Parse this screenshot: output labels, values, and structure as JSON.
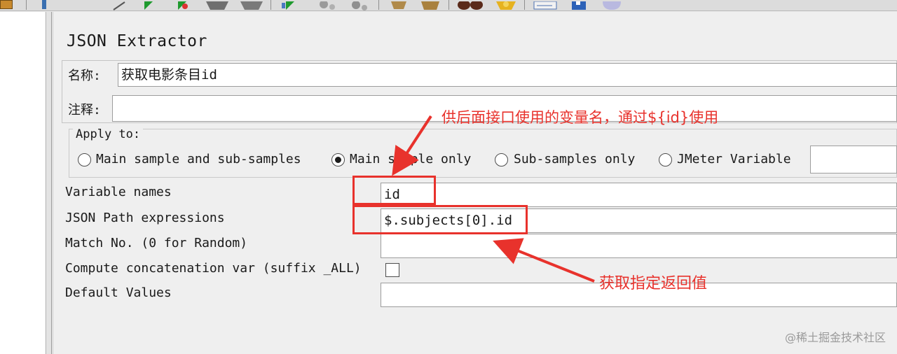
{
  "window": {
    "title": "JSON Extractor"
  },
  "form": {
    "name_label": "名称:",
    "name_value": "获取电影条目id",
    "comment_label": "注释:",
    "comment_value": ""
  },
  "apply_to": {
    "legend": "Apply to:",
    "options": [
      {
        "label": "Main sample and sub-samples",
        "selected": false
      },
      {
        "label": "Main sample only",
        "selected": true
      },
      {
        "label": "Sub-samples only",
        "selected": false
      },
      {
        "label": "JMeter Variable",
        "selected": false
      }
    ],
    "variable_value": ""
  },
  "fields": {
    "variable_names_label": "Variable names",
    "variable_names_value": "id",
    "json_path_label": "JSON Path expressions",
    "json_path_value": "$.subjects[0].id",
    "match_no_label": "Match No. (0 for Random)",
    "match_no_value": "",
    "concat_label": "Compute concatenation var (suffix _ALL)",
    "concat_checked": false,
    "default_values_label": "Default Values",
    "default_values_value": ""
  },
  "annotations": {
    "variable_note": "供后面接口使用的变量名，通过${id}使用",
    "path_note": "获取指定返回值",
    "highlight_color": "#e8322c"
  },
  "watermark": "@稀土掘金技术社区",
  "colors": {
    "panel_bg": "#efefef",
    "annotation_red": "#e8322c"
  },
  "toolbar_icons": [
    "document-icon",
    "wand-icon",
    "run-icon",
    "run-no-pause-icon",
    "stop-icon",
    "shutdown-icon",
    "remote-start-icon",
    "remote-stop-icon",
    "remote-shutdown-icon",
    "broom-icon",
    "clear-all-icon",
    "binoculars-icon",
    "reset-search-icon",
    "function-helper-icon",
    "help-icon",
    "toggle-icon"
  ]
}
